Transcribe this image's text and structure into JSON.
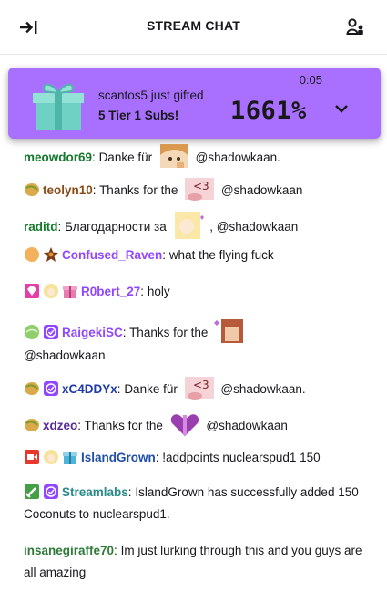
{
  "header": {
    "title": "STREAM CHAT",
    "collapse_icon": "collapse-arrow-icon",
    "users_icon": "community-users-icon"
  },
  "banner": {
    "line1": "scantos5 just gifted",
    "line2": "5 Tier 1 Subs!",
    "time": "0:05",
    "percent": "1661%",
    "icon": "gift-icon",
    "color": "#a970ff"
  },
  "messages": [
    {
      "user": "meowdor69",
      "colon": ":",
      "parts": [
        "Danke für",
        "@shadowkaan."
      ]
    },
    {
      "user": "teolyn10",
      "colon": ":",
      "parts": [
        "Thanks for the",
        "@shadowkaan"
      ]
    },
    {
      "user": "raditd",
      "colon": ":",
      "parts": [
        "Благодарности за",
        ", @shadowkaan"
      ]
    },
    {
      "user": "Confused_Raven",
      "colon": ":",
      "parts": [
        "what the flying fuck"
      ]
    },
    {
      "user": "R0bert_27",
      "colon": ":",
      "parts": [
        "holy"
      ]
    },
    {
      "user": "RaigekiSC",
      "colon": ":",
      "parts": [
        "Thanks for the",
        "@shadowkaan"
      ]
    },
    {
      "user": "xC4DDYx",
      "colon": ":",
      "parts": [
        "Danke für",
        "@shadowkaan."
      ]
    },
    {
      "user": "xdzeo",
      "colon": ":",
      "parts": [
        "Thanks for the",
        "@shadowkaan"
      ]
    },
    {
      "user": "IslandGrown",
      "colon": ":",
      "parts": [
        "!addpoints nuclearspud1 150"
      ]
    },
    {
      "user": "Streamlabs",
      "colon": ":",
      "parts": [
        "IslandGrown has successfully added 150 Coconuts to nuclearspud1."
      ]
    },
    {
      "user": "insanegiraffe70",
      "colon": ":",
      "parts": [
        "Im just lurking through this and you guys are all amazing"
      ]
    }
  ]
}
